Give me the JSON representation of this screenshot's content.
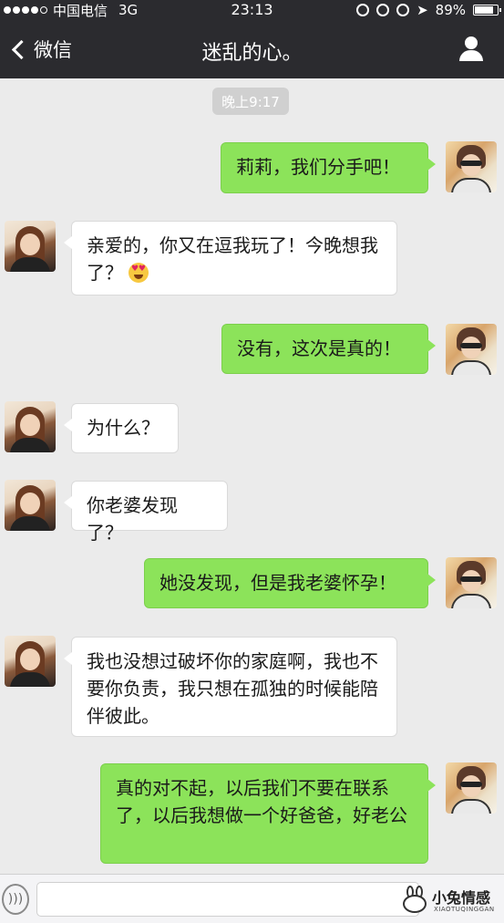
{
  "status_bar": {
    "carrier": "中国电信",
    "network": "3G",
    "time": "23:13",
    "battery": "89%",
    "battery_level": 0.89
  },
  "nav": {
    "back_label": "微信",
    "title": "迷乱的心。"
  },
  "chat": {
    "timestamp": "晚上9:17",
    "messages": [
      {
        "from": "me",
        "text": "莉莉，我们分手吧！"
      },
      {
        "from": "her",
        "text": "亲爱的，你又在逗我玩了！今晚想我了？",
        "emoji": "heart-eyes-emoji"
      },
      {
        "from": "me",
        "text": "没有，这次是真的！"
      },
      {
        "from": "her",
        "text": "为什么？"
      },
      {
        "from": "her",
        "text": "你老婆发现了？"
      },
      {
        "from": "me",
        "text": "她没发现，但是我老婆怀孕！"
      },
      {
        "from": "her",
        "text": "我也没想过破坏你的家庭啊，我也不要你负责，我只想在孤独的时候能陪伴彼此。"
      },
      {
        "from": "me",
        "text": "真的对不起，以后我们不要在联系了，以后我想做一个好爸爸，好老公"
      }
    ]
  },
  "input_bar": {
    "input_value": ""
  },
  "watermark": {
    "title": "小兔情感",
    "subtitle": "XIAOTUQINGGAN"
  },
  "colors": {
    "bar_bg": "#2b2b2f",
    "chat_bg": "#ebebeb",
    "outgoing_bubble": "#8ce35a",
    "incoming_bubble": "#ffffff",
    "timestamp_bg": "#d0d0d0"
  }
}
